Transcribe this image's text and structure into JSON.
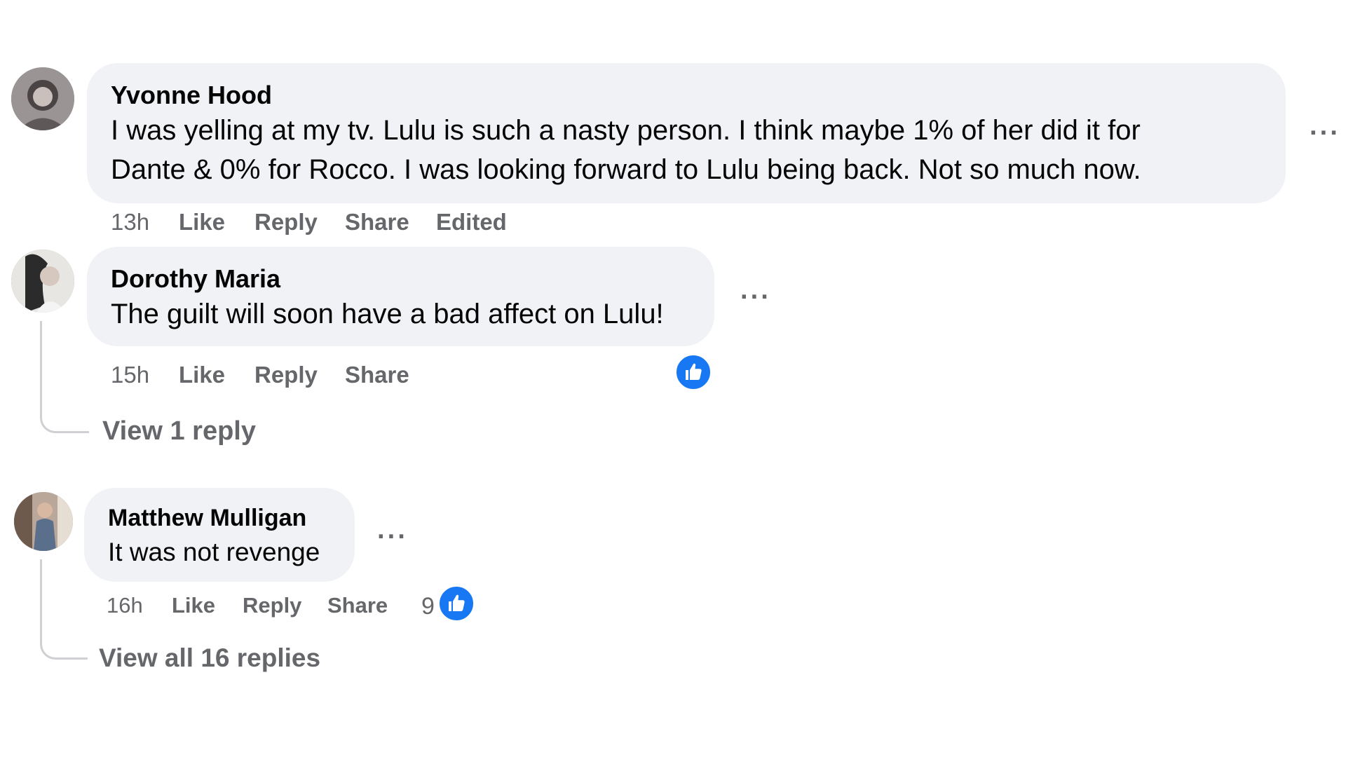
{
  "comments": [
    {
      "author": "Yvonne Hood",
      "text_line1": "I was yelling at my tv. Lulu is such a nasty person. I think maybe 1% of her did it for",
      "text_line2": "Dante & 0% for Rocco. I was looking forward to Lulu being back. Not so much now.",
      "time": "13h",
      "like": "Like",
      "reply": "Reply",
      "share": "Share",
      "edited": "Edited",
      "more": "···"
    },
    {
      "author": "Dorothy Maria",
      "text": "The guilt will soon have a bad affect on Lulu!",
      "time": "15h",
      "like": "Like",
      "reply": "Reply",
      "share": "Share",
      "view_replies": "View 1 reply",
      "more": "···",
      "reaction_icon": "like-icon"
    },
    {
      "author": "Matthew Mulligan",
      "text": "It was not revenge",
      "time": "16h",
      "like": "Like",
      "reply": "Reply",
      "share": "Share",
      "reaction_count": "9",
      "view_replies": "View all 16 replies",
      "more": "···",
      "reaction_icon": "like-icon"
    }
  ],
  "colors": {
    "bubble": "#f0f2f5",
    "meta_text": "#65676b",
    "like_blue": "#1877f2",
    "thread_line": "#ced0d4"
  }
}
